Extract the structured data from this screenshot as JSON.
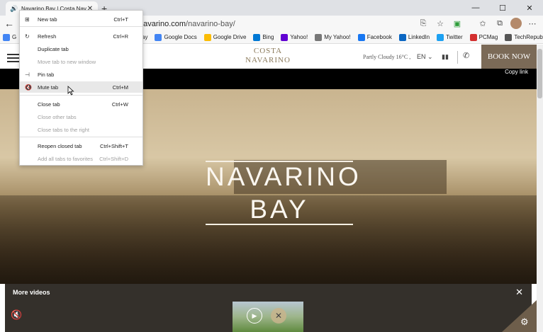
{
  "browser": {
    "tab_title": "Navarino Bay | Costa Navarino",
    "address_host": "navarino.com",
    "address_path": "/navarino-bay/",
    "favorites": [
      {
        "label": "G",
        "icon": "google-icon",
        "color": "#4285f4"
      },
      {
        "label": "e Play",
        "icon": "google-play-icon",
        "color": "#34a853"
      },
      {
        "label": "Google Docs",
        "icon": "google-icon",
        "color": "#4285f4"
      },
      {
        "label": "Google Drive",
        "icon": "google-drive-icon",
        "color": "#fbbc05"
      },
      {
        "label": "Bing",
        "icon": "bing-icon",
        "color": "#0078d4"
      },
      {
        "label": "Yahoo!",
        "icon": "yahoo-icon",
        "color": "#6001d2"
      },
      {
        "label": "My Yahoo!",
        "icon": "page-icon",
        "color": "#777777"
      },
      {
        "label": "Facebook",
        "icon": "facebook-icon",
        "color": "#1877f2"
      },
      {
        "label": "LinkedIn",
        "icon": "linkedin-icon",
        "color": "#0a66c2"
      },
      {
        "label": "Twitter",
        "icon": "twitter-icon",
        "color": "#1da1f2"
      },
      {
        "label": "PCMag",
        "icon": "pcmag-icon",
        "color": "#d32f2f"
      },
      {
        "label": "TechRepublic",
        "icon": "techrepublic-icon",
        "color": "#555555"
      }
    ]
  },
  "context_menu": {
    "items": [
      {
        "label": "New tab",
        "shortcut": "Ctrl+T",
        "icon": "new-tab-icon",
        "disabled": false
      },
      {
        "label": "Refresh",
        "shortcut": "Ctrl+R",
        "icon": "refresh-icon",
        "disabled": false
      },
      {
        "label": "Duplicate tab",
        "shortcut": "",
        "icon": "",
        "disabled": false
      },
      {
        "label": "Move tab to new window",
        "shortcut": "",
        "icon": "",
        "disabled": true
      },
      {
        "label": "Pin tab",
        "shortcut": "",
        "icon": "pin-icon",
        "disabled": false
      },
      {
        "label": "Mute tab",
        "shortcut": "Ctrl+M",
        "icon": "mute-icon",
        "disabled": false
      },
      {
        "label": "Close tab",
        "shortcut": "Ctrl+W",
        "icon": "",
        "disabled": false
      },
      {
        "label": "Close other tabs",
        "shortcut": "",
        "icon": "",
        "disabled": true
      },
      {
        "label": "Close tabs to the right",
        "shortcut": "",
        "icon": "",
        "disabled": true
      },
      {
        "label": "Reopen closed tab",
        "shortcut": "Ctrl+Shift+T",
        "icon": "",
        "disabled": false
      },
      {
        "label": "Add all tabs to favorites",
        "shortcut": "Ctrl+Shift+D",
        "icon": "",
        "disabled": true
      }
    ]
  },
  "site": {
    "logo_line1": "COSTA",
    "logo_line2": "NAVARINO",
    "weather": "Partly Cloudy 16°C ,",
    "language": "EN",
    "book_now": "BOOK NOW",
    "copy_link": "Copy link",
    "hero_line1": "NAVARINO",
    "hero_line2": "BAY",
    "more_videos": "More videos",
    "brand_color": "#7b6a57"
  }
}
